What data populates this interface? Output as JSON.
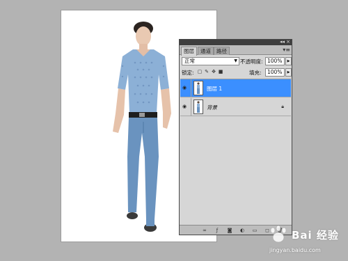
{
  "panel": {
    "tabs": [
      {
        "label": "图层",
        "active": true
      },
      {
        "label": "通道",
        "active": false
      },
      {
        "label": "路径",
        "active": false
      }
    ],
    "collapse_glyph": "◂◂",
    "close_glyph": "×",
    "menu_glyph": "▾≡",
    "blend_mode": "正常",
    "opacity_label": "不透明度:",
    "opacity_value": "100%",
    "lock_label": "锁定:",
    "fill_label": "填充:",
    "fill_value": "100%",
    "layers": [
      {
        "name": "图层 1",
        "selected": true,
        "visible": true,
        "locked": false
      },
      {
        "name": "背景",
        "selected": false,
        "visible": true,
        "locked": true
      }
    ],
    "bottom_icons": [
      "link-icon",
      "fx-icon",
      "mask-icon",
      "adjustment-icon",
      "group-icon",
      "new-layer-icon",
      "trash-icon"
    ]
  },
  "watermark": {
    "brand": "Bai 经验",
    "url": "jingyan.baidu.com"
  },
  "colors": {
    "desktop": "#b3b3b3",
    "panel": "#d6d6d6",
    "selected_layer": "#3b8fff"
  }
}
